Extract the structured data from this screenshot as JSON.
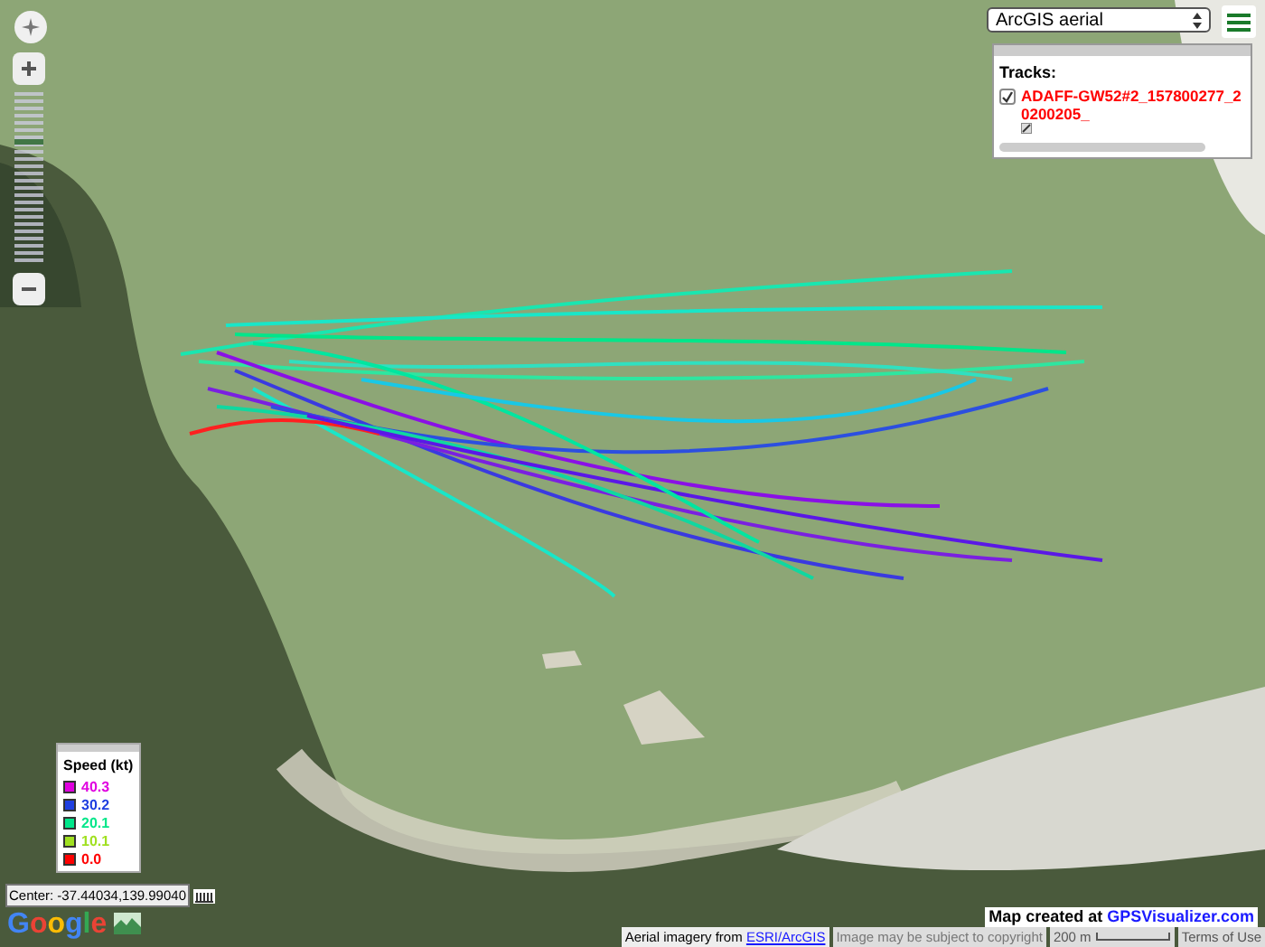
{
  "map_type": {
    "value": "ArcGIS aerial"
  },
  "zoom": {
    "level": 0.72
  },
  "tracks_panel": {
    "title": "Tracks:",
    "tracks": [
      {
        "name": "ADAFF-GW52#2_157800277_20200205_",
        "checked": true,
        "color": "#ff0000"
      }
    ]
  },
  "legend": {
    "title": "Speed (kt)",
    "items": [
      {
        "label": "40.3",
        "color": "#e000e0"
      },
      {
        "label": "30.2",
        "color": "#1f3fe0"
      },
      {
        "label": "20.1",
        "color": "#00e68a"
      },
      {
        "label": "10.1",
        "color": "#a0e020"
      },
      {
        "label": "0.0",
        "color": "#ff0000"
      }
    ]
  },
  "center": "Center: -37.44034,139.99040",
  "google_logo": "Google",
  "credit": {
    "text": "Map created at",
    "link": "GPSVisualizer.com"
  },
  "attribution": {
    "text": "Aerial imagery from",
    "link": "ESRI/ArcGIS",
    "copyright": "Image may be subject to copyright",
    "scale": "200 m",
    "terms": "Terms of Use"
  }
}
